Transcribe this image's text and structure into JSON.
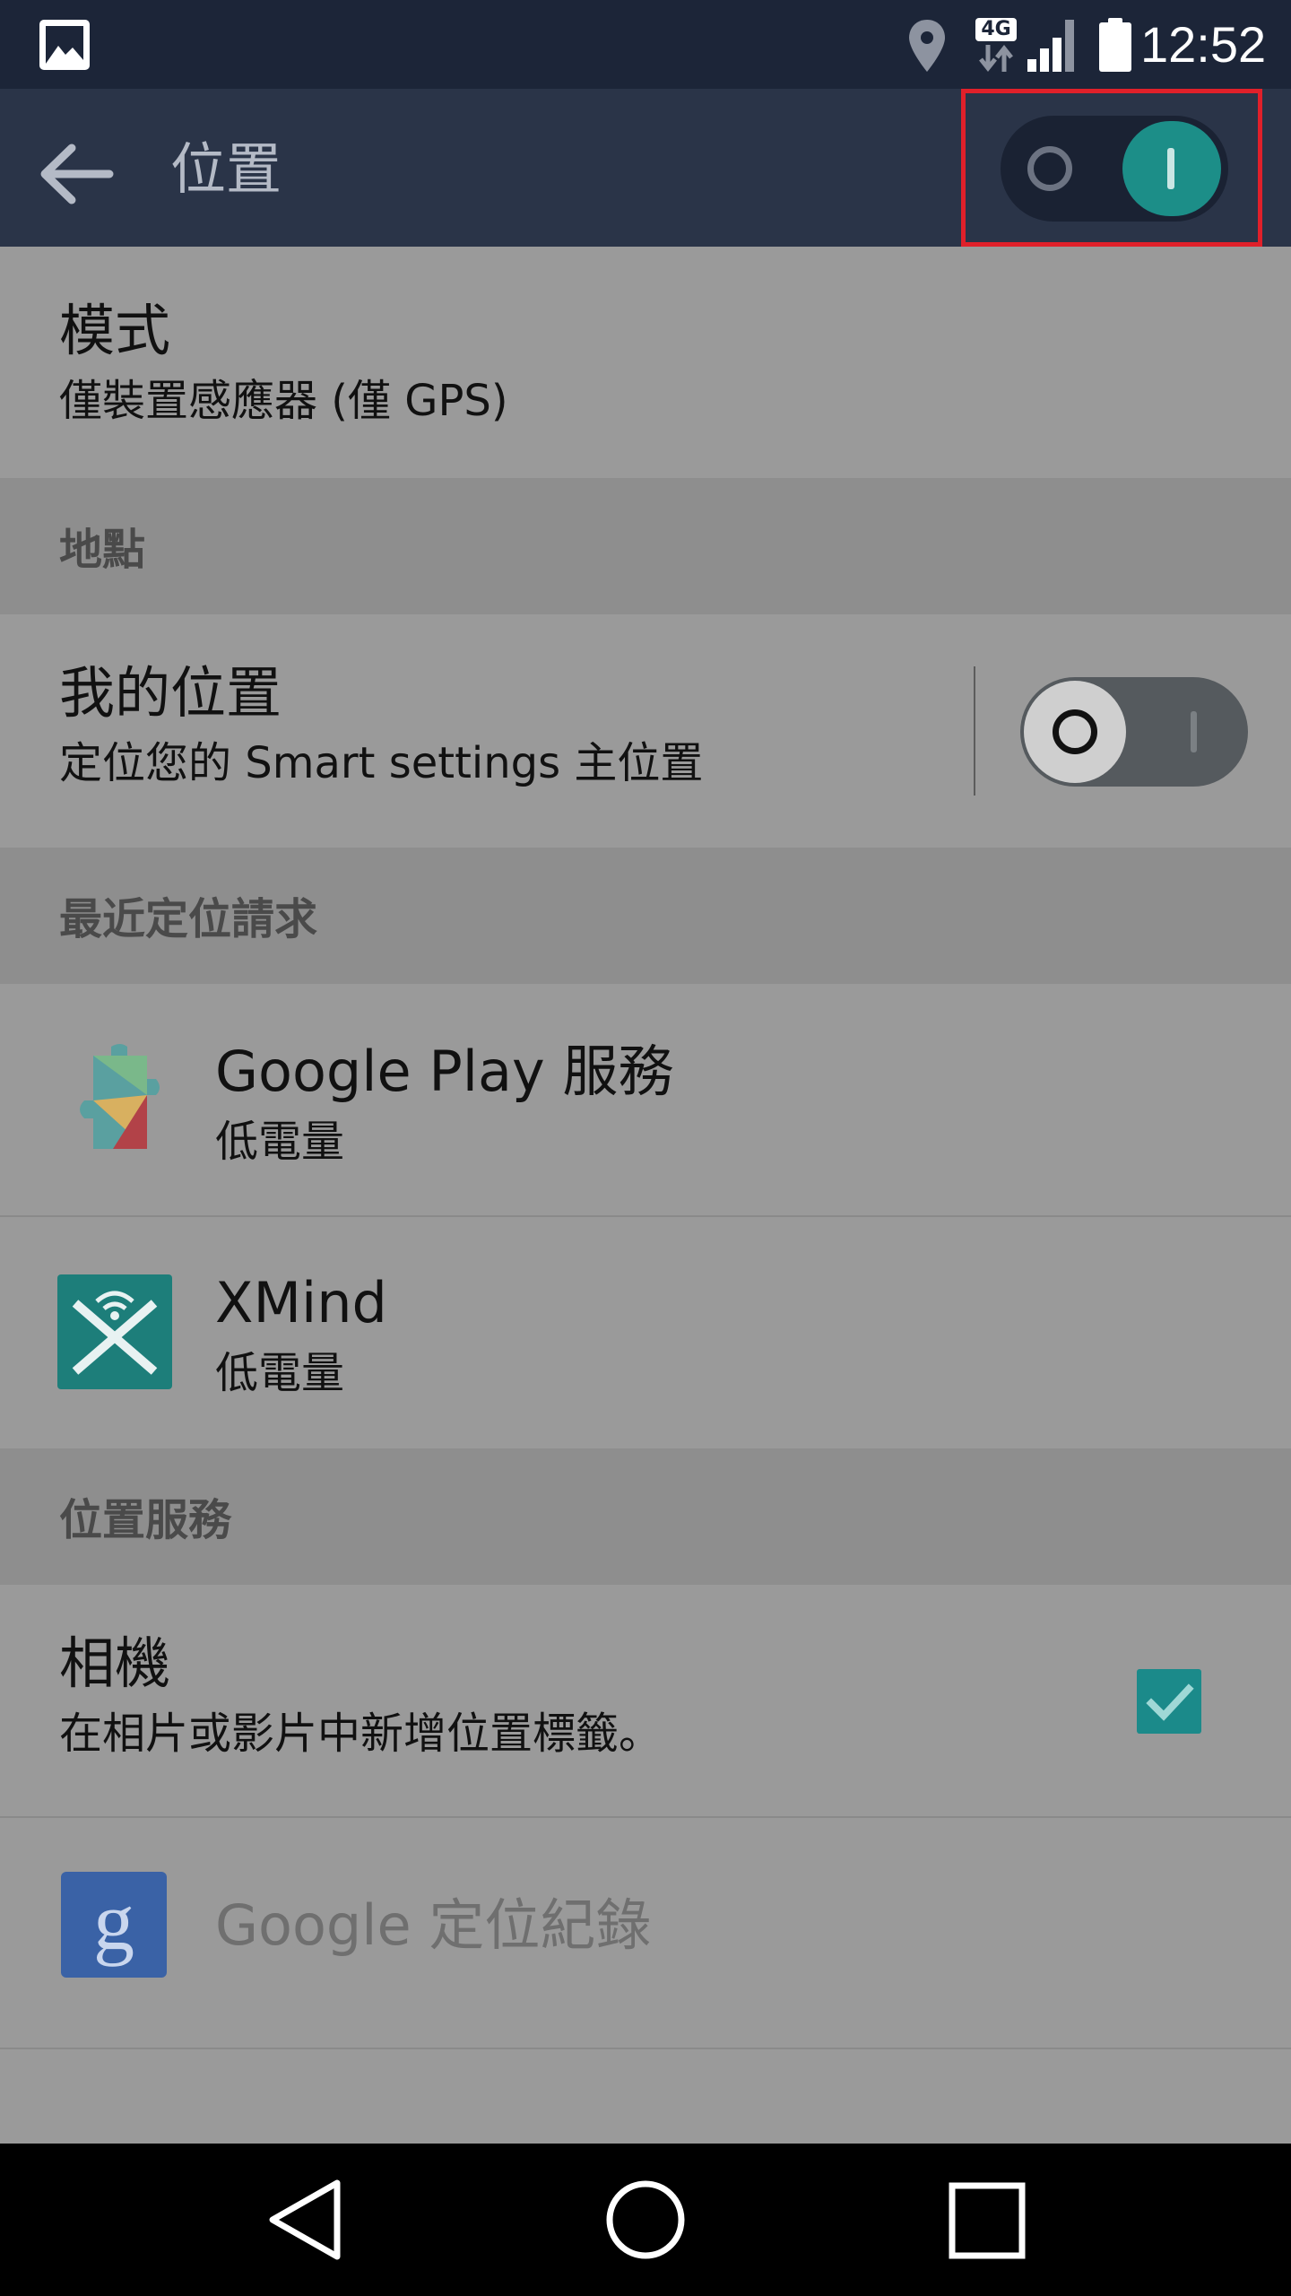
{
  "status_bar": {
    "time": "12:52",
    "network": "4G",
    "icons": [
      "gallery-icon",
      "location-icon",
      "network-4g-icon",
      "signal-icon",
      "battery-icon"
    ]
  },
  "toolbar": {
    "title": "位置",
    "back_icon": "arrow-left-icon",
    "master_switch_on": true
  },
  "mode": {
    "title": "模式",
    "value": "僅裝置感應器 (僅 GPS)"
  },
  "sections": {
    "places": "地點",
    "recent_requests": "最近定位請求",
    "location_services": "位置服務"
  },
  "my_location": {
    "title": "我的位置",
    "subtitle": "定位您的 Smart settings 主位置",
    "enabled": false
  },
  "recent_requests": [
    {
      "app": "Google Play 服務",
      "usage": "低電量",
      "icon": "google-play-services-icon"
    },
    {
      "app": "XMind",
      "usage": "低電量",
      "icon": "xmind-icon"
    }
  ],
  "camera": {
    "title": "相機",
    "subtitle": "在相片或影片中新增位置標籤。",
    "checked": true
  },
  "google_location_history": {
    "title": "Google 定位紀錄",
    "icon": "google-settings-icon"
  },
  "colors": {
    "accent": "#1c8e88",
    "toolbar": "#2a3448",
    "statusbar": "#1c2538",
    "highlight": "#e0202a"
  },
  "nav": [
    "back-icon",
    "home-icon",
    "recents-icon"
  ]
}
